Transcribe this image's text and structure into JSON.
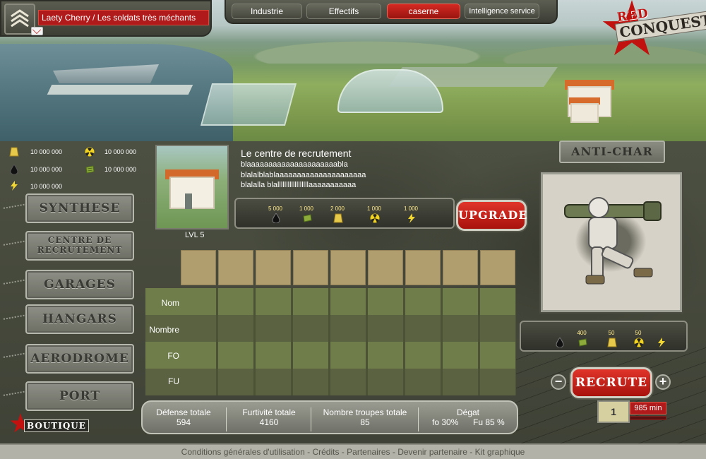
{
  "user": {
    "label": "Laety Cherry  /  Les soldats très méchants"
  },
  "nav": [
    {
      "label": "Industrie"
    },
    {
      "label": "Effectifs"
    },
    {
      "label": "caserne"
    },
    {
      "label": "Intelligence service"
    }
  ],
  "logo": {
    "line1": "RED",
    "line2": "CONQUEST"
  },
  "resources": [
    {
      "icon": "gold-bar-icon",
      "value": "10 000 000"
    },
    {
      "icon": "radioactive-icon",
      "value": "10 000 000"
    },
    {
      "icon": "oil-drop-icon",
      "value": "10 000 000"
    },
    {
      "icon": "cash-stack-icon",
      "value": "10 000 000"
    },
    {
      "icon": "lightning-icon",
      "value": "10 000 000"
    }
  ],
  "building": {
    "title": "Le centre de recrutement",
    "desc": [
      "blaaaaaaaaaaaaaaaaaaaaabla",
      "blalalblablaaaaaaaaaaaaaaaaaaaaa",
      "blalalla blallllllllllllllllllaaaaaaaaaaa"
    ],
    "level": "LVL  5"
  },
  "upgrade_cost": [
    "5 000",
    "1 000",
    "2 000",
    "1 000",
    "1 000"
  ],
  "upgrade_label": "UPGRADE",
  "side_menu": [
    {
      "label": "SYNTHESE"
    },
    {
      "label": "CENTRE DE RECRUTEMENT"
    },
    {
      "label": "GARAGES"
    },
    {
      "label": "HANGARS"
    },
    {
      "label": "AERODROME"
    },
    {
      "label": "PORT"
    }
  ],
  "table": {
    "rows": [
      "Nom",
      "Nombre",
      "FO",
      "FU"
    ]
  },
  "stats": {
    "defense_label": "Défense totale",
    "defense_value": "594",
    "stealth_label": "Furtivité totale",
    "stealth_value": "4160",
    "troops_label": "Nombre troupes totale",
    "troops_value": "85",
    "damage_label": "Dégat",
    "damage_fo": "fo 30%",
    "damage_fu": "Fu  85 %"
  },
  "unit": {
    "title": "ANTI-CHAR",
    "cost": [
      "",
      "400",
      "50",
      "50",
      ""
    ],
    "recruit_label": "RECRUTE",
    "quantity": "1",
    "time": "985 min"
  },
  "boutique": "BOUTIQUE",
  "footer": [
    "Conditions générales d'utilisation",
    "Crédits",
    "Partenaires",
    "Devenir partenaire",
    "Kit graphique"
  ],
  "colors": {
    "accent_red": "#b01a1a",
    "gold": "#b19e6f",
    "olive": "#6e7d4a"
  }
}
